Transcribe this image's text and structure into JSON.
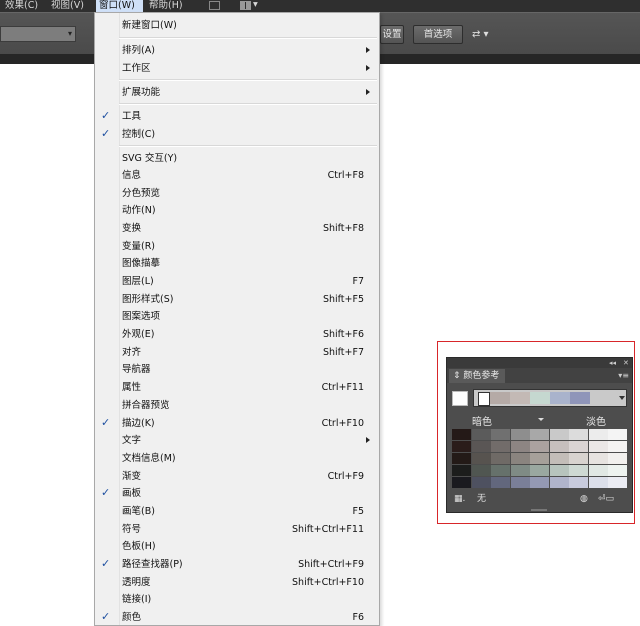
{
  "menubar": {
    "items": [
      {
        "label": "效果(C)",
        "active": false
      },
      {
        "label": "视图(V)",
        "active": false
      },
      {
        "label": "窗口(W)",
        "active": true
      },
      {
        "label": "帮助(H)",
        "active": false
      }
    ]
  },
  "controlbar": {
    "field_value": "",
    "btn_a": "设置",
    "btn_b": "首选项",
    "icon": "arrange-icon"
  },
  "menu": {
    "items": [
      {
        "label": "新建窗口(W)",
        "shortcut": "",
        "checked": false,
        "submenu": false
      },
      {
        "label": "排列(A)",
        "shortcut": "",
        "checked": false,
        "submenu": true
      },
      {
        "label": "工作区",
        "shortcut": "",
        "checked": false,
        "submenu": true
      },
      {
        "label": "扩展功能",
        "shortcut": "",
        "checked": false,
        "submenu": true
      },
      {
        "label": "工具",
        "shortcut": "",
        "checked": true,
        "submenu": false
      },
      {
        "label": "控制(C)",
        "shortcut": "",
        "checked": true,
        "submenu": false
      },
      {
        "label": "SVG 交互(Y)",
        "shortcut": "",
        "checked": false,
        "submenu": false
      },
      {
        "label": "信息",
        "shortcut": "Ctrl+F8",
        "checked": false,
        "submenu": false
      },
      {
        "label": "分色预览",
        "shortcut": "",
        "checked": false,
        "submenu": false
      },
      {
        "label": "动作(N)",
        "shortcut": "",
        "checked": false,
        "submenu": false
      },
      {
        "label": "变换",
        "shortcut": "Shift+F8",
        "checked": false,
        "submenu": false
      },
      {
        "label": "变量(R)",
        "shortcut": "",
        "checked": false,
        "submenu": false
      },
      {
        "label": "图像描摹",
        "shortcut": "",
        "checked": false,
        "submenu": false
      },
      {
        "label": "图层(L)",
        "shortcut": "F7",
        "checked": false,
        "submenu": false
      },
      {
        "label": "图形样式(S)",
        "shortcut": "Shift+F5",
        "checked": false,
        "submenu": false
      },
      {
        "label": "图案选项",
        "shortcut": "",
        "checked": false,
        "submenu": false
      },
      {
        "label": "外观(E)",
        "shortcut": "Shift+F6",
        "checked": false,
        "submenu": false
      },
      {
        "label": "对齐",
        "shortcut": "Shift+F7",
        "checked": false,
        "submenu": false
      },
      {
        "label": "导航器",
        "shortcut": "",
        "checked": false,
        "submenu": false
      },
      {
        "label": "属性",
        "shortcut": "Ctrl+F11",
        "checked": false,
        "submenu": false
      },
      {
        "label": "拼合器预览",
        "shortcut": "",
        "checked": false,
        "submenu": false
      },
      {
        "label": "描边(K)",
        "shortcut": "Ctrl+F10",
        "checked": true,
        "submenu": false
      },
      {
        "label": "文字",
        "shortcut": "",
        "checked": false,
        "submenu": true
      },
      {
        "label": "文档信息(M)",
        "shortcut": "",
        "checked": false,
        "submenu": false
      },
      {
        "label": "渐变",
        "shortcut": "Ctrl+F9",
        "checked": false,
        "submenu": false
      },
      {
        "label": "画板",
        "shortcut": "",
        "checked": true,
        "submenu": false
      },
      {
        "label": "画笔(B)",
        "shortcut": "F5",
        "checked": false,
        "submenu": false
      },
      {
        "label": "符号",
        "shortcut": "Shift+Ctrl+F11",
        "checked": false,
        "submenu": false
      },
      {
        "label": "色板(H)",
        "shortcut": "",
        "checked": false,
        "submenu": false
      },
      {
        "label": "路径查找器(P)",
        "shortcut": "Shift+Ctrl+F9",
        "checked": true,
        "submenu": false
      },
      {
        "label": "透明度",
        "shortcut": "Shift+Ctrl+F10",
        "checked": false,
        "submenu": false
      },
      {
        "label": "链接(I)",
        "shortcut": "",
        "checked": false,
        "submenu": false
      },
      {
        "label": "颜色",
        "shortcut": "F6",
        "checked": true,
        "submenu": false
      }
    ]
  },
  "panel": {
    "tab_label": "颜色参考",
    "dark_label": "暗色",
    "light_label": "淡色",
    "bottom_none_label": "无",
    "colors": {
      "bar": [
        "#ffffff",
        "#b5aaa6",
        "#c3b9b5",
        "#c5d8d0",
        "#a9b3cc",
        "#8f95b9"
      ],
      "grid_rows": [
        [
          "#241917",
          "#5b5b5b",
          "#707070",
          "#8e8e8e",
          "#a8a8a8",
          "#c9c9c9",
          "#dcdcdc",
          "#ececec",
          "#f4f4f4"
        ],
        [
          "#2a1c1a",
          "#5a5655",
          "#726c6a",
          "#8d8583",
          "#aba2a0",
          "#c6bfbd",
          "#dad4d3",
          "#ebe7e6",
          "#f5f3f2"
        ],
        [
          "#231a17",
          "#57534f",
          "#6f6a66",
          "#8a847f",
          "#a6a09a",
          "#c3bdb8",
          "#d8d3cf",
          "#e7e3e0",
          "#f2f0ee"
        ],
        [
          "#1c1d1c",
          "#505651",
          "#66716b",
          "#7f8b85",
          "#9aa8a0",
          "#b7c4bd",
          "#ced9d3",
          "#e1e8e4",
          "#eef3f0"
        ],
        [
          "#1a1a1f",
          "#4e5160",
          "#62677d",
          "#7a7f98",
          "#9499b3",
          "#b0b4cb",
          "#c8cbdd",
          "#dcdfea",
          "#ebecf3"
        ]
      ]
    }
  }
}
